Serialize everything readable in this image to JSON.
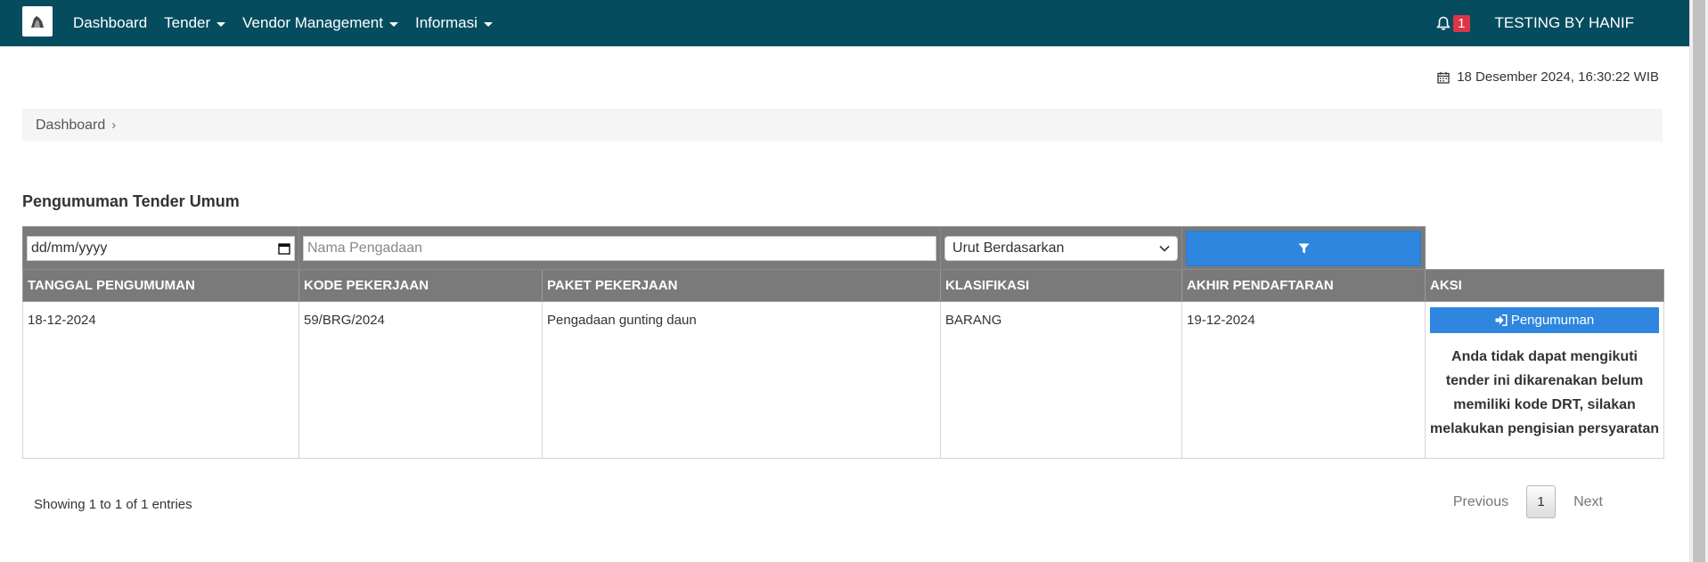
{
  "navbar": {
    "items": [
      {
        "label": "Dashboard",
        "dropdown": false
      },
      {
        "label": "Tender",
        "dropdown": true
      },
      {
        "label": "Vendor Management",
        "dropdown": true
      },
      {
        "label": "Informasi",
        "dropdown": true
      }
    ],
    "notification_count": "1",
    "user_name": "TESTING BY HANIF",
    "bg_color": "#064c5f"
  },
  "datetime": "18 Desember 2024, 16:30:22 WIB",
  "breadcrumb": {
    "items": [
      "Dashboard"
    ]
  },
  "section_title": "Pengumuman Tender Umum",
  "filters": {
    "date_placeholder": "dd/mm/yyyy",
    "name_placeholder": "Nama Pengadaan",
    "sort_selected": "Urut Berdasarkan"
  },
  "table": {
    "columns": [
      "TANGGAL PENGUMUMAN",
      "KODE PEKERJAAN",
      "PAKET PEKERJAAN",
      "KLASIFIKASI",
      "AKHIR PENDAFTARAN",
      "AKSI"
    ],
    "rows": [
      {
        "tanggal": "18-12-2024",
        "kode": "59/BRG/2024",
        "paket": "Pengadaan gunting daun",
        "klasifikasi": "BARANG",
        "akhir": "19-12-2024",
        "button_label": "Pengumuman",
        "note": "Anda tidak dapat mengikuti tender ini dikarenakan belum memiliki kode DRT, silakan melakukan pengisian persyaratan"
      }
    ]
  },
  "footer": {
    "entries_info": "Showing 1 to 1 of 1 entries",
    "prev_label": "Previous",
    "current_page": "1",
    "next_label": "Next"
  },
  "colors": {
    "primary_button": "#2e86de",
    "table_header": "#7a7a7a",
    "badge": "#dc3545"
  }
}
